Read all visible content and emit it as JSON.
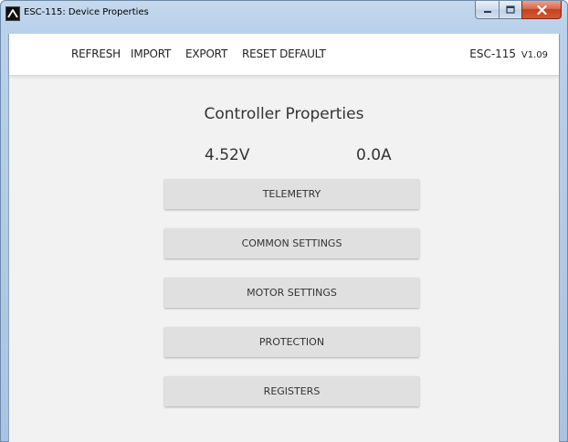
{
  "window": {
    "title": "ESC-115: Device Properties"
  },
  "menu": {
    "refresh": "REFRESH",
    "import": "IMPORT",
    "export": "EXPORT",
    "reset_default": "RESET DEFAULT"
  },
  "device": {
    "name": "ESC-115",
    "version": "V1.09"
  },
  "main": {
    "heading": "Controller Properties",
    "voltage": "4.52V",
    "current": "0.0A",
    "buttons": [
      {
        "label": "TELEMETRY"
      },
      {
        "label": "COMMON SETTINGS"
      },
      {
        "label": "MOTOR SETTINGS"
      },
      {
        "label": "PROTECTION"
      },
      {
        "label": "REGISTERS"
      }
    ]
  },
  "icons": {
    "app": "app-logo-icon",
    "minimize": "minimize-icon",
    "maximize": "maximize-icon",
    "close": "close-icon"
  },
  "colors": {
    "window_frame": "#b9d1ea",
    "client_bg": "#f2f2f2",
    "button_bg": "#e0e0e0",
    "close_button": "#c4411f"
  }
}
